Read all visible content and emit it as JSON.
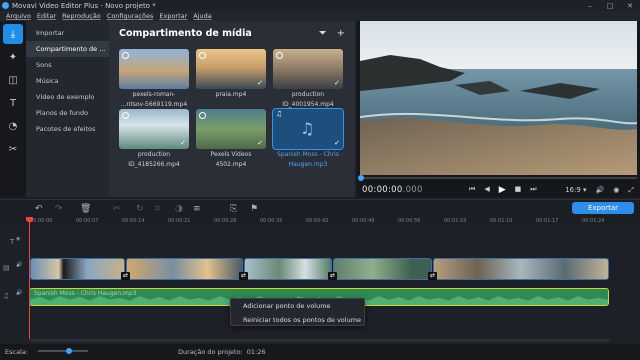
{
  "window": {
    "title": "Movavi Video Editor Plus - Novo projeto *",
    "controls": [
      "–",
      "□",
      "✕"
    ]
  },
  "menu": [
    "Arquivo",
    "Editar",
    "Reprodução",
    "Configurações",
    "Exportar",
    "Ajuda"
  ],
  "tools": [
    {
      "name": "import-tool",
      "glyph": "⤓"
    },
    {
      "name": "filters-tool",
      "glyph": "✦"
    },
    {
      "name": "transitions-tool",
      "glyph": "◫"
    },
    {
      "name": "titles-tool",
      "glyph": "T"
    },
    {
      "name": "stickers-tool",
      "glyph": "◔"
    },
    {
      "name": "more-tools",
      "glyph": "✂"
    }
  ],
  "categories": [
    {
      "label": "Importar",
      "active": false
    },
    {
      "label": "Compartimento de mídia",
      "active": true
    },
    {
      "label": "Sons",
      "active": false
    },
    {
      "label": "Música",
      "active": false
    },
    {
      "label": "Vídeo de exemplo",
      "active": false
    },
    {
      "label": "Planos de fundo",
      "active": false
    },
    {
      "label": "Pacotes de efeitos",
      "active": false
    }
  ],
  "media": {
    "title": "Compartimento de mídia",
    "items": [
      {
        "line1": "pexels-roman-",
        "line2": "...ntsov-5669119.mp4"
      },
      {
        "line1": "praia.mp4",
        "line2": ""
      },
      {
        "line1": "production",
        "line2": "ID_4001954.mp4"
      },
      {
        "line1": "production",
        "line2": "ID_4185266.mp4"
      },
      {
        "line1": "Pexels Videos",
        "line2": "4502.mp4"
      },
      {
        "line1": "Spanish Moss - Chris",
        "line2": "Haugen.mp3"
      }
    ]
  },
  "player": {
    "time": "00:00:00",
    "time_ms": ".000",
    "aspect": "16:9 ▾",
    "progress": 0
  },
  "timeline": {
    "export_label": "Exportar",
    "ruler": [
      "00:00:00",
      "00:00:07",
      "00:00:14",
      "00:00:21",
      "00:00:28",
      "00:00:35",
      "00:00:42",
      "00:00:49",
      "00:00:56",
      "00:01:03",
      "00:01:10",
      "00:01:17",
      "00:01:24"
    ],
    "audio_label": "Spanish Moss - Chris Haugen.mp3",
    "context_menu": [
      "Adicionar ponto de volume",
      "Reiniciar todos os pontos de volume"
    ]
  },
  "status": {
    "scale_label": "Escala:",
    "duration_label": "Duração do projeto:",
    "duration_value": "01:26"
  },
  "colors": {
    "accent": "#2f8ee8",
    "playhead": "#e8453c",
    "audio": "#2e8a52"
  }
}
